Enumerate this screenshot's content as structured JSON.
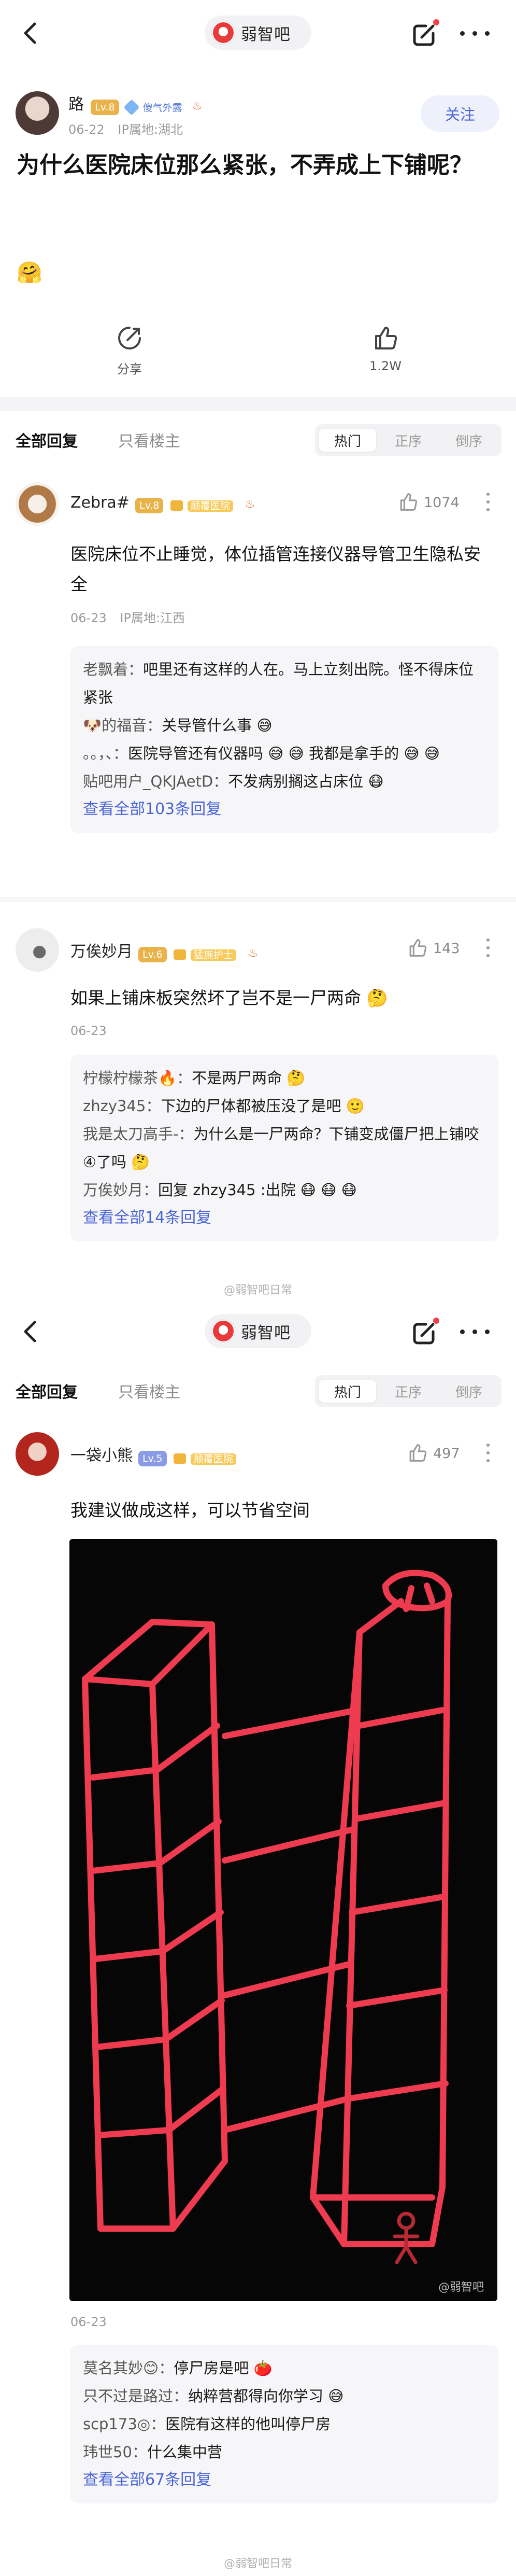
{
  "nav": {
    "forum_name": "弱智吧",
    "back_icon": "chevron-left-icon",
    "share_icon": "share-edit-icon",
    "more_icon": "more-horizontal-icon"
  },
  "post": {
    "author": "路",
    "level": "Lv.8",
    "badge": "傻气外露",
    "date": "06-22",
    "ip": "IP属地:湖北",
    "follow_label": "关注",
    "title": "为什么医院床位那么紧张，不弄成上下铺呢？",
    "emoji": "🤗",
    "share_label": "分享",
    "like_count": "1.2W"
  },
  "filter": {
    "all_replies": "全部回复",
    "only_op": "只看楼主",
    "sort_hot": "热门",
    "sort_asc": "正序",
    "sort_desc": "倒序"
  },
  "comments": [
    {
      "author": "Zebra#",
      "level": "Lv.8",
      "badge": "颠覆医院",
      "likes": "1074",
      "text": "医院床位不止睡觉，体位插管连接仪器导管卫生隐私安全",
      "date": "06-23",
      "ip": "IP属地:江西",
      "replies": [
        {
          "who": "老飘着：",
          "text": "吧里还有这样的人在。马上立刻出院。怪不得床位紧张"
        },
        {
          "who": "🐶的福音：",
          "text": "关导管什么事 😅"
        },
        {
          "who": "。。，、：",
          "text": "医院导管还有仪器吗 😅 😅 我都是拿手的 😅 😅"
        },
        {
          "who": "贴吧用户_QKJAetD：",
          "text": "不发病别搁这占床位 😷"
        }
      ],
      "see_all": "查看全部103条回复"
    },
    {
      "author": "万俟妙月",
      "level": "Lv.6",
      "badge": "猛施护士",
      "likes": "143",
      "text": "如果上铺床板突然坏了岂不是一尸两命 🤔",
      "date": "06-23",
      "replies": [
        {
          "who": "柠檬柠檬茶🔥：",
          "text": "不是两尸两命 🤔"
        },
        {
          "who": "zhzy345：",
          "text": "下边的尸体都被压没了是吧 🙂"
        },
        {
          "who": "我是太刀高手-：",
          "text": "为什么是一尸两命？下铺变成僵尸把上铺咬④了吗 🤔"
        },
        {
          "who": "万俟妙月：",
          "text": "回复 zhzy345 :出院 😷 😷 😷"
        }
      ],
      "see_all": "查看全部14条回复"
    },
    {
      "author": "一袋小熊",
      "level": "Lv.5",
      "badge": "颠覆医院",
      "likes": "497",
      "text": "我建议做成这样，可以节省空间",
      "date": "06-23",
      "image_watermark": "@弱智吧",
      "replies": [
        {
          "who": "莫名其妙😊：",
          "text": "停尸房是吧 🍅"
        },
        {
          "who": "只不过是路过：",
          "text": "纳粹营都得向你学习 😅"
        },
        {
          "who": "scp173◎：",
          "text": "医院有这样的他叫停尸房"
        },
        {
          "who": "玮世50：",
          "text": "什么集中营"
        }
      ],
      "see_all": "查看全部67条回复"
    }
  ],
  "watermarks": [
    "@弱智吧日常",
    "@弱智吧日常"
  ],
  "colors": {
    "accent": "#4a64d6",
    "level_gold": "#e9b34a",
    "level_blue": "#8a9be6",
    "sketch_line": "#ef3b50",
    "sketch_bg": "#060606"
  }
}
